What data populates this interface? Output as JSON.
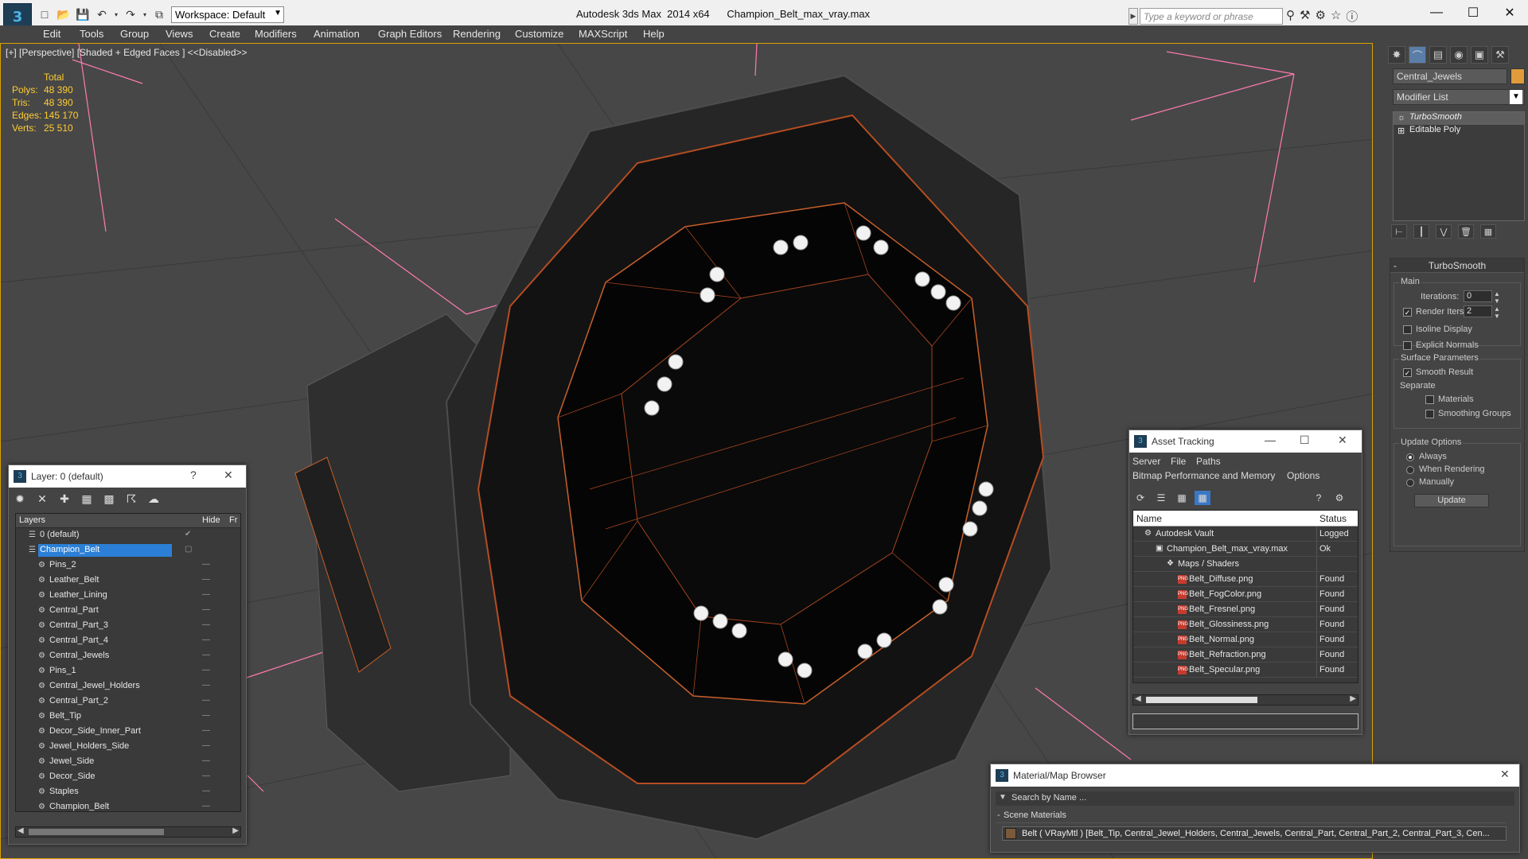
{
  "app": {
    "title": "Autodesk 3ds Max  2014 x64",
    "file": "Champion_Belt_max_vray.max",
    "workspace": "Workspace: Default",
    "search_placeholder": "Type a keyword or phrase"
  },
  "menu": [
    "Edit",
    "Tools",
    "Group",
    "Views",
    "Create",
    "Modifiers",
    "Animation",
    "Graph Editors",
    "Rendering",
    "Customize",
    "MAXScript",
    "Help"
  ],
  "viewport": {
    "label": "[+] [Perspective] [Shaded + Edged Faces ]  <<Disabled>>",
    "stats": {
      "header": "Total",
      "polys_label": "Polys:",
      "polys": "48 390",
      "tris_label": "Tris:",
      "tris": "48 390",
      "edges_label": "Edges:",
      "edges": "145 170",
      "verts_label": "Verts:",
      "verts": "25 510"
    }
  },
  "command_panel": {
    "object_name": "Central_Jewels",
    "object_color": "#e09b3b",
    "modifier_list": "Modifier List",
    "stack": [
      "TurboSmooth",
      "Editable Poly"
    ],
    "turbosmooth": {
      "title": "TurboSmooth",
      "main": "Main",
      "iterations_label": "Iterations:",
      "iterations": "0",
      "render_iters_label": "Render Iters:",
      "render_iters": "2",
      "isoline": "Isoline Display",
      "explicit_normals": "Explicit Normals",
      "surface_params": "Surface Parameters",
      "smooth_result": "Smooth Result",
      "separate": "Separate",
      "materials": "Materials",
      "smoothing_groups": "Smoothing Groups",
      "update_options": "Update Options",
      "always": "Always",
      "when_rendering": "When Rendering",
      "manually": "Manually",
      "update_button": "Update"
    }
  },
  "layer_dialog": {
    "title": "Layer: 0 (default)",
    "help": "?",
    "col_layers": "Layers",
    "col_hide": "Hide",
    "col_fr": "Fr",
    "rows": [
      {
        "name": "0 (default)",
        "level": 0
      },
      {
        "name": "Champion_Belt",
        "level": 0
      },
      {
        "name": "Pins_2",
        "level": 1
      },
      {
        "name": "Leather_Belt",
        "level": 1
      },
      {
        "name": "Leather_Lining",
        "level": 1
      },
      {
        "name": "Central_Part",
        "level": 1
      },
      {
        "name": "Central_Part_3",
        "level": 1
      },
      {
        "name": "Central_Part_4",
        "level": 1
      },
      {
        "name": "Central_Jewels",
        "level": 1
      },
      {
        "name": "Pins_1",
        "level": 1
      },
      {
        "name": "Central_Jewel_Holders",
        "level": 1
      },
      {
        "name": "Central_Part_2",
        "level": 1
      },
      {
        "name": "Belt_Tip",
        "level": 1
      },
      {
        "name": "Decor_Side_Inner_Part",
        "level": 1
      },
      {
        "name": "Jewel_Holders_Side",
        "level": 1
      },
      {
        "name": "Jewel_Side",
        "level": 1
      },
      {
        "name": "Decor_Side",
        "level": 1
      },
      {
        "name": "Staples",
        "level": 1
      },
      {
        "name": "Champion_Belt",
        "level": 1
      }
    ]
  },
  "asset_tracking": {
    "title": "Asset Tracking",
    "menu": [
      "Server",
      "File",
      "Paths"
    ],
    "menu2": [
      "Bitmap Performance and Memory",
      "Options"
    ],
    "col_name": "Name",
    "col_status": "Status",
    "rows": [
      {
        "name": "Autodesk Vault",
        "status": "Logged",
        "indent": 0
      },
      {
        "name": "Champion_Belt_max_vray.max",
        "status": "Ok",
        "indent": 1
      },
      {
        "name": "Maps / Shaders",
        "status": "",
        "indent": 2
      },
      {
        "name": "Belt_Diffuse.png",
        "status": "Found",
        "indent": 3
      },
      {
        "name": "Belt_FogColor.png",
        "status": "Found",
        "indent": 3
      },
      {
        "name": "Belt_Fresnel.png",
        "status": "Found",
        "indent": 3
      },
      {
        "name": "Belt_Glossiness.png",
        "status": "Found",
        "indent": 3
      },
      {
        "name": "Belt_Normal.png",
        "status": "Found",
        "indent": 3
      },
      {
        "name": "Belt_Refraction.png",
        "status": "Found",
        "indent": 3
      },
      {
        "name": "Belt_Specular.png",
        "status": "Found",
        "indent": 3
      }
    ]
  },
  "material_browser": {
    "title": "Material/Map Browser",
    "search": "Search by Name ...",
    "section": "Scene Materials",
    "row": "Belt  ( VRayMtl )  [Belt_Tip, Central_Jewel_Holders, Central_Jewels, Central_Part, Central_Part_2, Central_Part_3, Cen..."
  }
}
